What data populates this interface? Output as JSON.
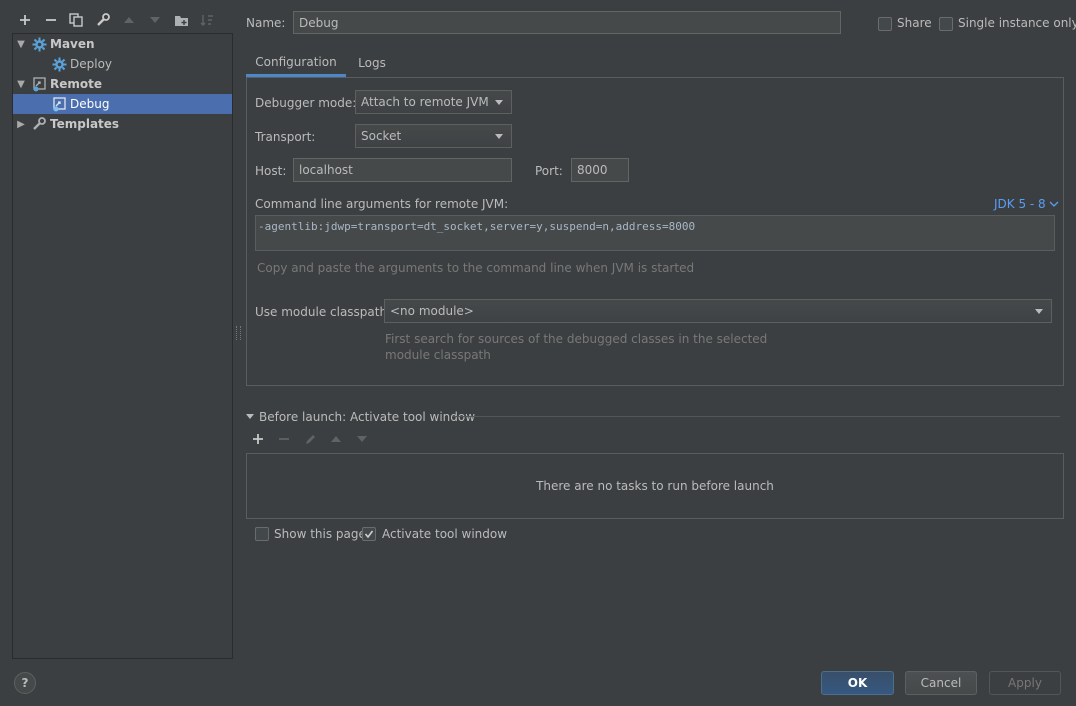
{
  "toolbar": {
    "icons": [
      "add-icon",
      "remove-icon",
      "copy-icon",
      "wrench-icon",
      "move-up-icon",
      "move-down-icon",
      "folder-icon",
      "sort-icon"
    ]
  },
  "tree": {
    "items": [
      {
        "label": "Maven",
        "bold": true,
        "expanded": true
      },
      {
        "label": "Deploy",
        "bold": false
      },
      {
        "label": "Remote",
        "bold": true,
        "expanded": true
      },
      {
        "label": "Debug",
        "bold": false,
        "selected": true
      },
      {
        "label": "Templates",
        "bold": true,
        "expanded": false
      }
    ]
  },
  "header": {
    "name_label": "Name:",
    "name_value": "Debug",
    "share_label": "Share",
    "single_instance_label": "Single instance only"
  },
  "tabs": [
    {
      "label": "Configuration",
      "active": true
    },
    {
      "label": "Logs",
      "active": false
    }
  ],
  "config": {
    "debugger_mode_label": "Debugger mode:",
    "debugger_mode_value": "Attach to remote JVM",
    "transport_label": "Transport:",
    "transport_value": "Socket",
    "host_label": "Host:",
    "host_value": "localhost",
    "port_label": "Port:",
    "port_value": "8000",
    "cmdline_label": "Command line arguments for remote JVM:",
    "jdk_link": "JDK 5 - 8",
    "cmdline_value": "-agentlib:jdwp=transport=dt_socket,server=y,suspend=n,address=8000",
    "cmdline_hint": "Copy and paste the arguments to the command line when JVM is started",
    "module_label": "Use module classpath:",
    "module_value": "<no module>",
    "module_hint_line1": "First search for sources of the debugged classes in the selected",
    "module_hint_line2": "module classpath"
  },
  "before_launch": {
    "title": "Before launch: Activate tool window",
    "empty_text": "There are no tasks to run before launch",
    "show_page_label": "Show this page",
    "show_page_checked": false,
    "activate_label": "Activate tool window",
    "activate_checked": true
  },
  "footer": {
    "help": "?",
    "ok": "OK",
    "cancel": "Cancel",
    "apply": "Apply"
  }
}
